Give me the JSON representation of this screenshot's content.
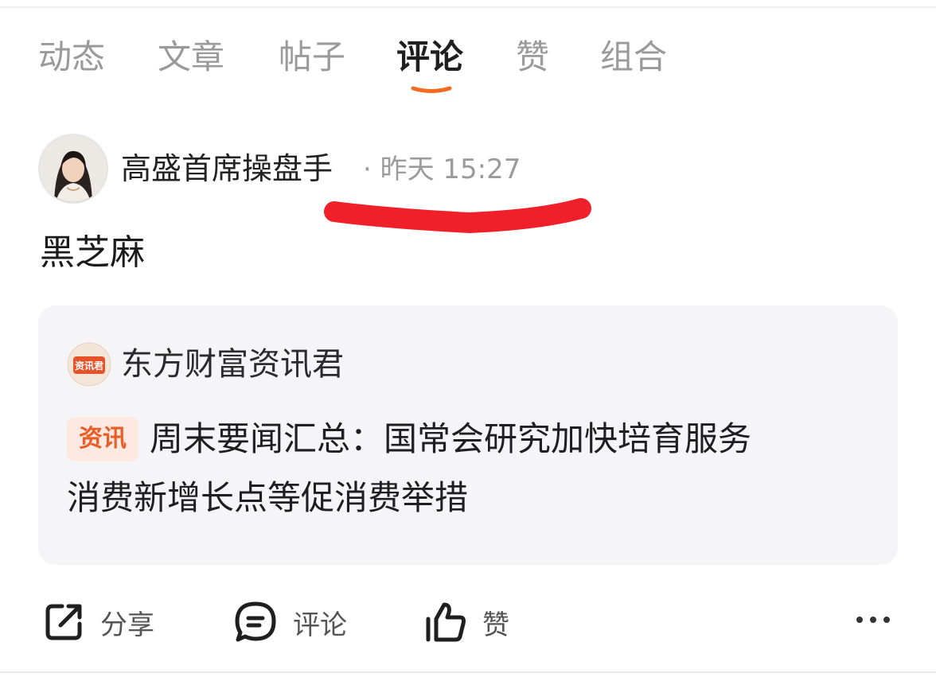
{
  "tabs": [
    {
      "label": "动态",
      "active": false
    },
    {
      "label": "文章",
      "active": false
    },
    {
      "label": "帖子",
      "active": false
    },
    {
      "label": "评论",
      "active": true
    },
    {
      "label": "赞",
      "active": false
    },
    {
      "label": "组合",
      "active": false
    }
  ],
  "post": {
    "author": "高盛首席操盘手",
    "time": "· 昨天 15:27",
    "comment": "黑芝麻"
  },
  "card": {
    "source_name": "东方财富资讯君",
    "source_icon_text": "资讯君",
    "badge": "资讯",
    "headline_line1": "周末要闻汇总：国常会研究加快培育服务",
    "headline_line2": "消费新增长点等促消费举措"
  },
  "actions": {
    "share": "分享",
    "comment": "评论",
    "like": "赞"
  },
  "colors": {
    "accent": "#f36b21",
    "scribble": "#f0202a",
    "badge_bg": "#fde9e1",
    "card_bg": "#f5f5f7"
  }
}
